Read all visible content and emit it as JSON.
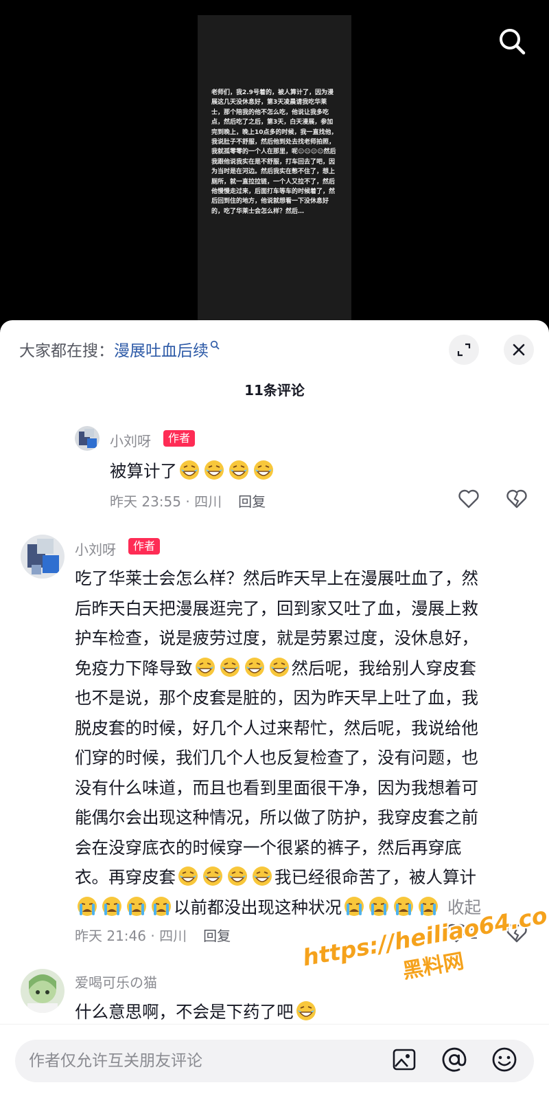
{
  "video": {
    "text": "老师们，我2.9号着的，被人算计了，因为漫展这几天没休息好，第3天凌晨请我吃华莱士，那个陪我的他不怎么吃，他说让我多吃点，然后吃了之后，第3天，白天漫展，参加完到晚上，晚上10点多的时候，我一直找他，我说肚子不舒服，然后他到处去找老师拍照，我就孤零零的一个人在那里，呢😐😐😐😐然后我跟他说我实在是不舒服，打车回去了吧，因为当时是在河边。然后我实在憋不住了，想上厕所，就一直拉拉链，一个人又拉不了，然后他慢慢走过来，后面打车等车的时候着了，然后回到住的地方，他说就想看一下没休息好的，吃了华莱士会怎么样？然后…"
  },
  "header": {
    "suggest_prefix": "大家都在搜：",
    "suggest_keyword": "漫展吐血后续",
    "comment_count": "11条评论"
  },
  "comments": [
    {
      "name": "小刘呀",
      "tag": "作者",
      "text_parts": [
        "被算计了"
      ],
      "time": "昨天 23:55 · 四川",
      "reply": "回复"
    },
    {
      "name": "小刘呀",
      "tag": "作者",
      "lines": [
        "吃了华莱士会怎么样？然后昨天早上在漫展吐血了，然",
        "后昨天白天把漫展逛完了，回到家又吐了血，漫展上救",
        "护车检查，说是疲劳过度，就是劳累过度，没休息好，",
        "免疫力下降导致",
        "然后呢，我给别人穿皮套",
        "也不是说，那个皮套是脏的，因为昨天早上吐了血，我",
        "脱皮套的时候，好几个人过来帮忙，然后呢，我说给他",
        "们穿的时候，我们几个人也反复检查了，没有问题，也",
        "没有什么味道，而且也看到里面很干净，因为我想着可",
        "能偶尔会出现这种情况，所以做了防护，我穿皮套之前",
        "会在没穿底衣的时候穿一个很紧的裤子，然后再穿底",
        "衣。再穿皮套",
        "我已经很命苦了，被人算计",
        "以前都没出现这种状况"
      ],
      "fold": "收起",
      "time": "昨天 21:46 · 四川",
      "reply": "回复",
      "likes": "1"
    },
    {
      "name": "爱喝可乐の猫",
      "text": "什么意思啊，不会是下药了吧"
    }
  ],
  "input": {
    "placeholder": "作者仅允许互关朋友评论"
  },
  "watermark": {
    "url": "https://heiliao64.com",
    "name": "黑料网"
  }
}
